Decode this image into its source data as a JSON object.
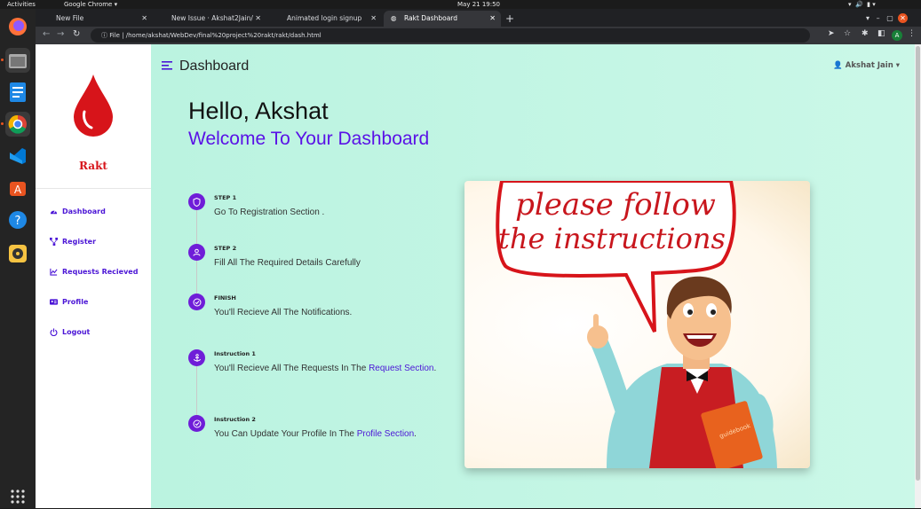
{
  "system": {
    "activities": "Activities",
    "app_name": "Google Chrome",
    "clock": "May 21  19:50"
  },
  "browser": {
    "tabs": [
      {
        "title": "New File"
      },
      {
        "title": "New Issue · Akshat2Jain/"
      },
      {
        "title": "Animated login signup"
      },
      {
        "title": "Rakt Dashboard"
      }
    ],
    "address": "/home/akshat/WebDev/final%20project%20rakt/rakt/dash.html",
    "address_prefix": "File",
    "profile_initial": "A"
  },
  "sidebar": {
    "brand": "Rakt",
    "items": [
      {
        "label": "Dashboard",
        "icon": "gauge-icon"
      },
      {
        "label": "Register",
        "icon": "sitemap-icon"
      },
      {
        "label": "Requests Recieved",
        "icon": "chart-line-icon"
      },
      {
        "label": "Profile",
        "icon": "id-card-icon"
      },
      {
        "label": "Logout",
        "icon": "power-icon"
      }
    ]
  },
  "header": {
    "title": "Dashboard",
    "user": "Akshat Jain"
  },
  "main": {
    "hello": "Hello, Akshat",
    "welcome": "Welcome To Your Dashboard",
    "steps": [
      {
        "label": "STEP 1",
        "text": "Go To Registration Section .",
        "icon": "shield-icon"
      },
      {
        "label": "STEP 2",
        "text": "Fill All The Required Details Carefully",
        "icon": "user-icon"
      },
      {
        "label": "FINISH",
        "text": "You'll Recieve All The Notifications.",
        "icon": "check-circle-icon"
      }
    ],
    "instructions": [
      {
        "label": "Instruction 1",
        "text": "You'll Recieve All The Requests In The ",
        "link": "Request Section",
        "after": ".",
        "icon": "anchor-icon"
      },
      {
        "label": "Instruction 2",
        "text": "You Can Update Your Profile In The ",
        "link": "Profile Section",
        "after": ".",
        "icon": "check-circle-icon"
      }
    ],
    "illustration": {
      "bubble_line1": "please follow",
      "bubble_line2": "the instructions",
      "book_label": "guidebook"
    }
  },
  "colors": {
    "accent": "#5a12e6",
    "brand_red": "#d7141a",
    "background_start": "#b8f2df"
  }
}
